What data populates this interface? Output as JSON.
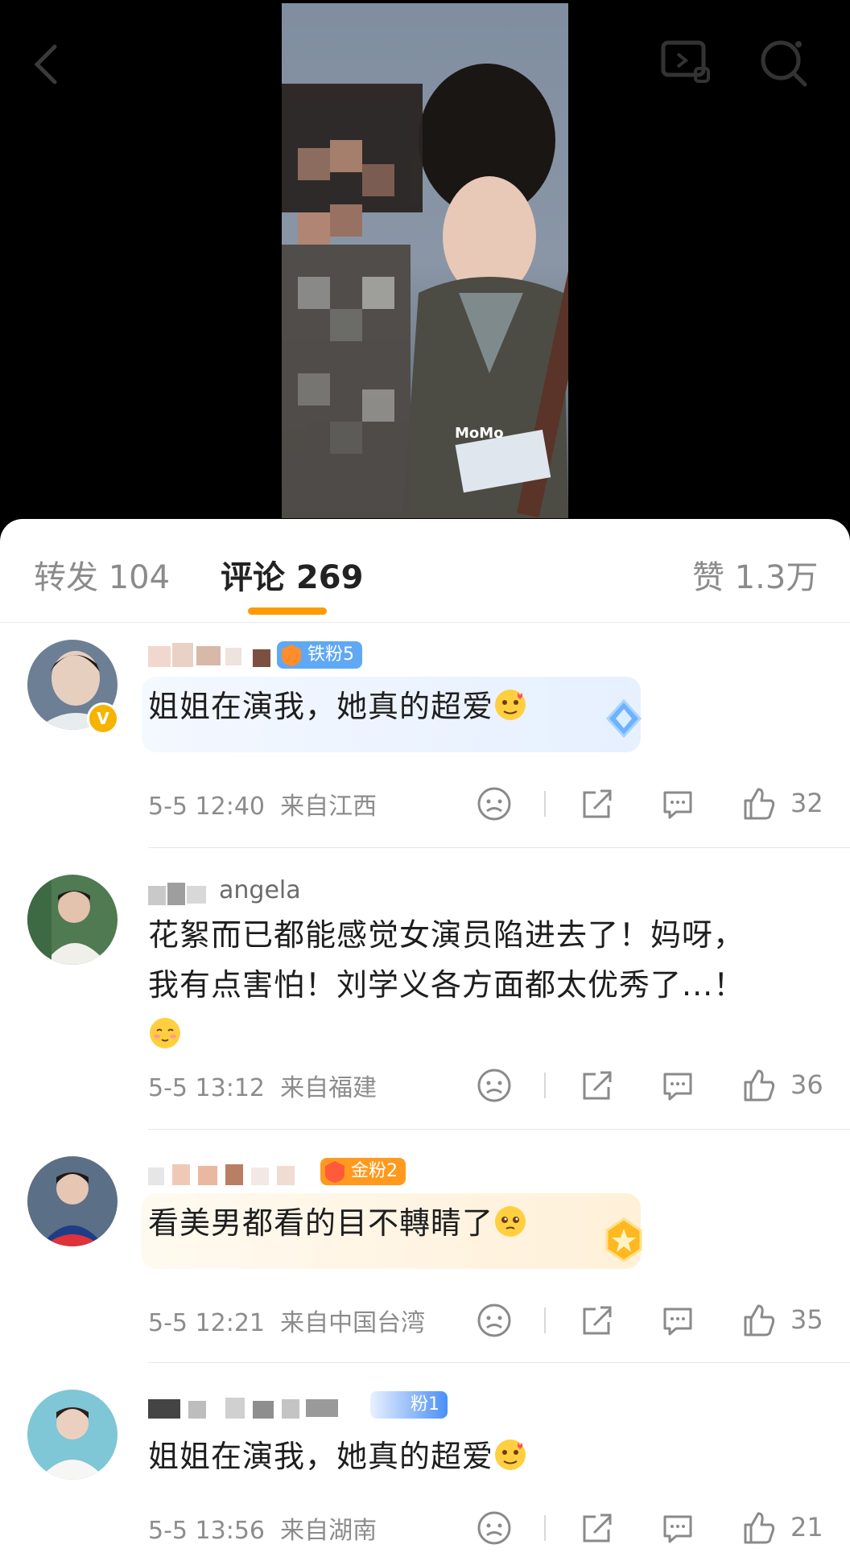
{
  "header": {
    "watermark": "MoMo"
  },
  "tabs": [
    {
      "label": "转发 104"
    },
    {
      "label": "评论 269"
    },
    {
      "label": "赞 1.3万"
    }
  ],
  "comments": [
    {
      "username": "",
      "fan_badge": "铁粉5",
      "text": "姐姐在演我，她真的超爱",
      "time": "5-5 12:40",
      "location": "来自江西",
      "likes": "32"
    },
    {
      "username": "angela",
      "fan_badge": "",
      "text_line1": "花絮而已都能感觉女演员陷进去了！妈呀，",
      "text_line2": "我有点害怕！刘学义各方面都太优秀了...！",
      "time": "5-5 13:12",
      "location": "来自福建",
      "likes": "36"
    },
    {
      "username": "",
      "fan_badge": "金粉2",
      "text": "看美男都看的目不轉睛了",
      "time": "5-5 12:21",
      "location": "来自中国台湾",
      "likes": "35"
    },
    {
      "username": "",
      "fan_badge": "粉1",
      "text": "姐姐在演我，她真的超爱",
      "time": "5-5 13:56",
      "location": "来自湖南",
      "likes": "21"
    }
  ],
  "colors": {
    "accent": "#ff9a00",
    "iron_fan": "#5fa8f5",
    "gold_fan": "#ff9a1f",
    "fan1": "#4a8ff7"
  },
  "icons": [
    "back-icon",
    "cast-icon",
    "search-icon",
    "dislike-icon",
    "share-icon",
    "comment-icon",
    "like-icon"
  ]
}
